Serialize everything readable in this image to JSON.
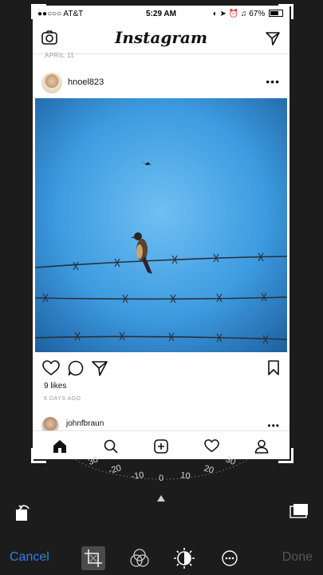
{
  "status_bar": {
    "carrier": "●●○○○ AT&T",
    "time": "5:29 AM",
    "battery": "67%"
  },
  "instagram": {
    "logo": "Instagram",
    "date_label": "APRIL 11",
    "post": {
      "username": "hnoel823",
      "likes": "9 likes",
      "posted": "6 DAYS AGO"
    },
    "next_post": {
      "username": "johnfbraun"
    },
    "icons": [
      "camera-icon",
      "direct-send-icon",
      "more-icon",
      "heart-icon",
      "comment-icon",
      "share-icon",
      "bookmark-icon",
      "home-icon",
      "search-icon",
      "add-icon",
      "activity-icon",
      "profile-icon"
    ]
  },
  "dial": {
    "labels": [
      "30",
      "-20",
      "-10",
      "0",
      "10",
      "20",
      "30"
    ]
  },
  "editor": {
    "cancel_label": "Cancel",
    "done_label": "Done",
    "tools": [
      "crop-icon",
      "filters-icon",
      "adjust-icon",
      "more-icon"
    ]
  },
  "colors": {
    "accent": "#2f7fe6",
    "background": "#1c1c1c",
    "sky": "#3d9be0"
  }
}
